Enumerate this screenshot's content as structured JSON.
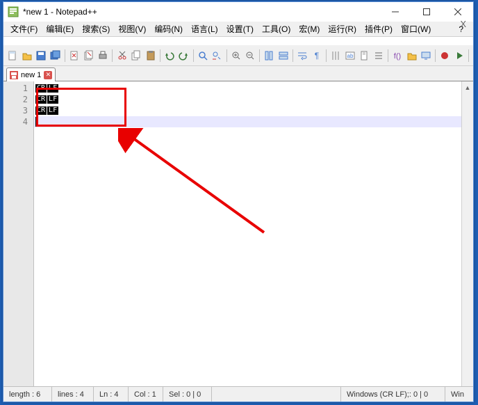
{
  "window": {
    "title": "*new 1 - Notepad++"
  },
  "menu": {
    "file": "文件(F)",
    "edit": "编辑(E)",
    "search": "搜索(S)",
    "view": "视图(V)",
    "encoding": "编码(N)",
    "language": "语言(L)",
    "settings": "设置(T)",
    "tools": "工具(O)",
    "macro": "宏(M)",
    "run": "运行(R)",
    "plugins": "插件(P)",
    "window": "窗口(W)",
    "help": "?"
  },
  "tab": {
    "label": "new 1"
  },
  "editor": {
    "lines": [
      {
        "num": "1",
        "eol_cr": "CR",
        "eol_lf": "LF"
      },
      {
        "num": "2",
        "eol_cr": "CR",
        "eol_lf": "LF"
      },
      {
        "num": "3",
        "eol_cr": "CR",
        "eol_lf": "LF"
      },
      {
        "num": "4",
        "eol_cr": "",
        "eol_lf": ""
      }
    ],
    "current_line": 4
  },
  "status": {
    "length": "length : 6",
    "lines": "lines : 4",
    "ln": "Ln : 4",
    "col": "Col : 1",
    "sel": "Sel : 0 | 0",
    "eol": "Windows (CR LF);: 0 | 0",
    "enc": "Win"
  },
  "toolbar_icons": [
    "new-file",
    "open-file",
    "save",
    "save-all",
    "sep",
    "close",
    "close-all",
    "print",
    "sep",
    "cut",
    "copy",
    "paste",
    "sep",
    "undo",
    "redo",
    "sep",
    "find",
    "replace",
    "sep",
    "zoom-in",
    "zoom-out",
    "sep",
    "sync-v",
    "sync-h",
    "sep",
    "word-wrap",
    "show-all",
    "sep",
    "indent-guide",
    "lang",
    "doc-map",
    "doc-list",
    "sep",
    "func-list",
    "folder",
    "monitor",
    "sep",
    "record",
    "play",
    "sep"
  ],
  "colors": {
    "accent": "#e80000",
    "highlight": "#e8e8ff"
  }
}
